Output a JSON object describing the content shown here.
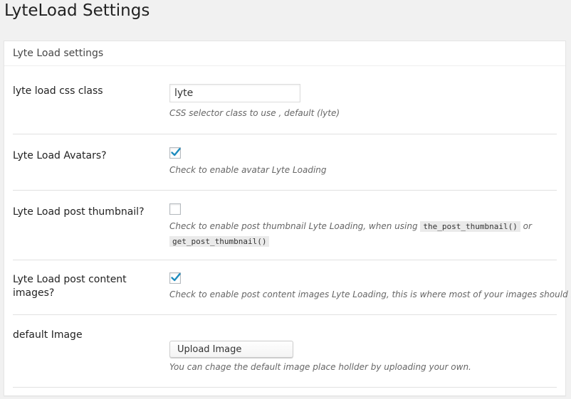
{
  "page": {
    "title": "LyteLoad Settings"
  },
  "panel": {
    "header": "Lyte Load settings"
  },
  "rows": {
    "css_class": {
      "label": "lyte load css class",
      "value": "lyte",
      "description": "CSS selector class to use , default (lyte)"
    },
    "avatars": {
      "label": "Lyte Load Avatars?",
      "checked": true,
      "description": "Check to enable avatar Lyte Loading"
    },
    "post_thumbnail": {
      "label": "Lyte Load post thumbnail?",
      "checked": false,
      "description_prefix": "Check to enable post thumbnail Lyte Loading, when using",
      "code_1": "the_post_thumbnail()",
      "description_or": "or",
      "code_2": "get_post_thumbnail()"
    },
    "content_images": {
      "label": "Lyte Load post content images?",
      "checked": true,
      "description": "Check to enable post content images Lyte Loading, this is where most of your images should be"
    },
    "default_image": {
      "label": "default Image",
      "button_label": "Upload Image",
      "description": "You can chage the default image place hollder by uploading your own."
    }
  },
  "colors": {
    "checkmark": "#1e8cbe",
    "background": "#f1f1f1",
    "panel": "#ffffff"
  },
  "icons": {
    "check": "checkmark-icon"
  }
}
